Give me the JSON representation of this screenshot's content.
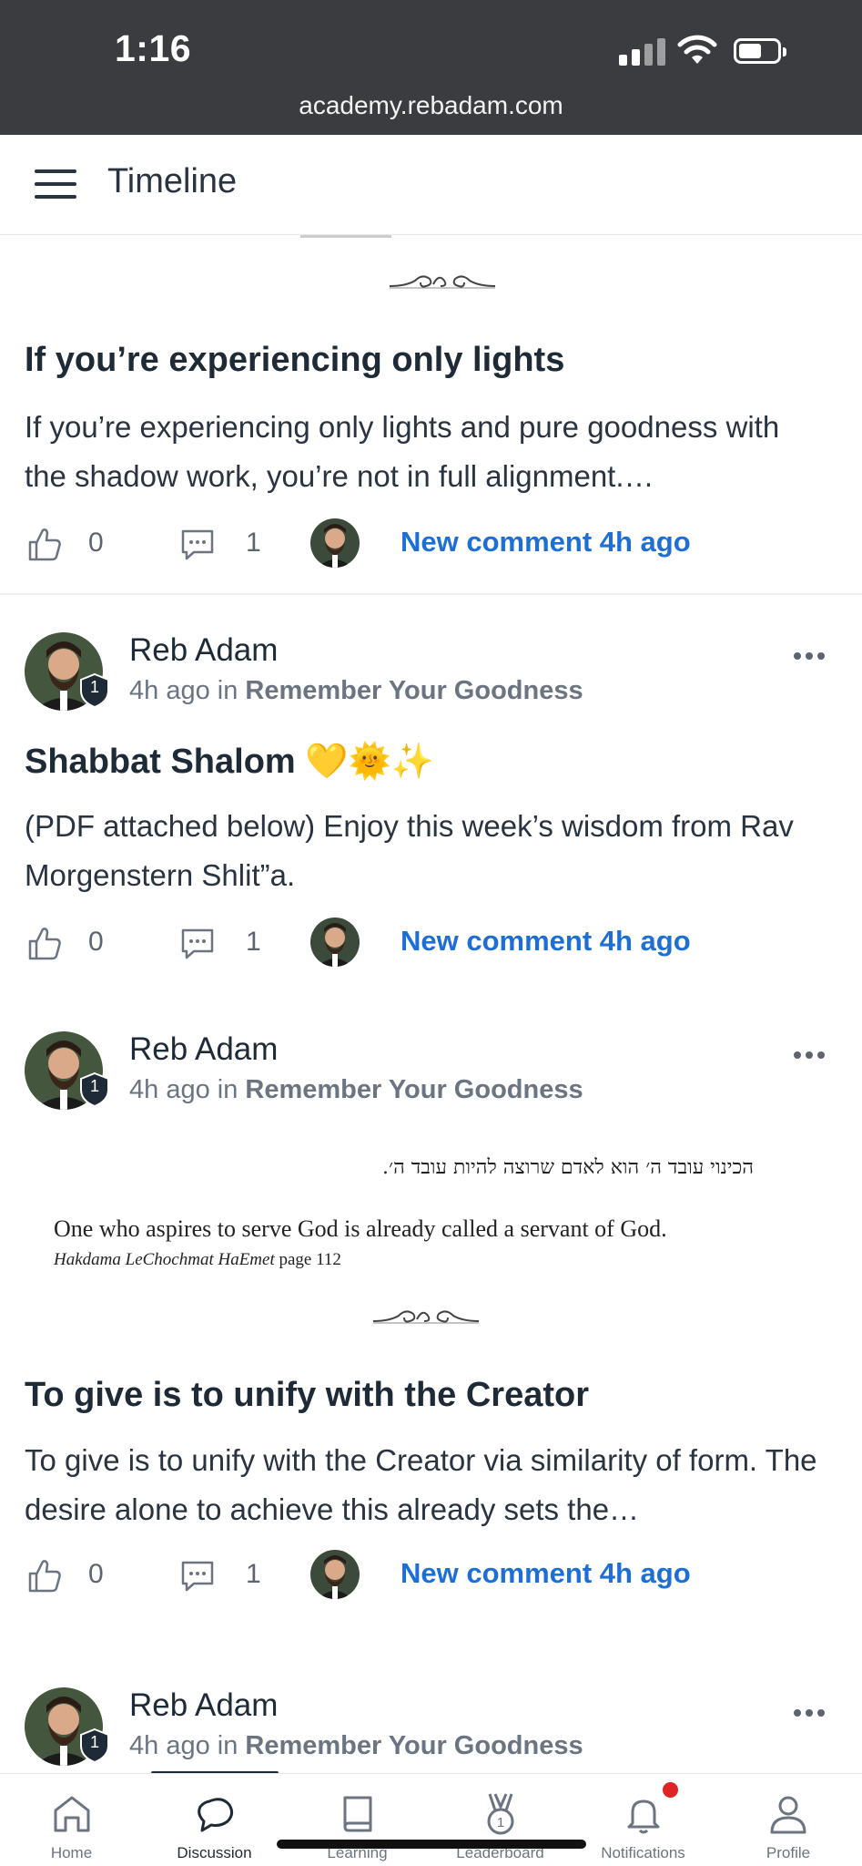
{
  "status_bar": {
    "time": "1:16",
    "url": "academy.rebadam.com",
    "icons": [
      "signal-icon",
      "wifi-icon",
      "battery-icon"
    ]
  },
  "header": {
    "title": "Timeline",
    "menu_icon": "hamburger-menu-icon"
  },
  "posts": [
    {
      "title": "If you’re experiencing only lights",
      "excerpt": "If you’re experiencing only lights and pure goodness with the shadow work, you’re not in full alignment.…",
      "likes": "0",
      "comments": "1",
      "new_comment": "New comment 4h ago"
    },
    {
      "author": "Reb Adam",
      "badge": "1",
      "time": "4h ago",
      "in_label": "in",
      "group": "Remember Your Goodness",
      "title": "Shabbat Shalom 💛🌞✨",
      "excerpt": "(PDF attached below) Enjoy this week’s wisdom from Rav Morgenstern Shlit”a.",
      "likes": "0",
      "comments": "1",
      "new_comment": "New comment 4h ago"
    },
    {
      "author": "Reb Adam",
      "badge": "1",
      "time": "4h ago",
      "in_label": "in",
      "group": "Remember Your Goodness",
      "image": {
        "hebrew": "הכינוי עובד ה׳ הוא לאדם שרוצה להיות עובד ה׳.",
        "english": "One who aspires to serve God is already called a servant of God.",
        "source_title": "Hakdama LeChochmat HaEmet",
        "source_page": " page 112"
      },
      "title": "To give is to unify with the Creator",
      "excerpt": "To give is to unify with the Creator via similarity of form. The desire alone to achieve this already sets the…",
      "likes": "0",
      "comments": "1",
      "new_comment": "New comment 4h ago"
    },
    {
      "author": "Reb Adam",
      "badge": "1",
      "time": "4h ago",
      "in_label": "in",
      "group": "Remember Your Goodness"
    }
  ],
  "tabbar": {
    "tabs": [
      {
        "label": "Home",
        "icon": "home-icon"
      },
      {
        "label": "Discussion",
        "icon": "discussion-icon"
      },
      {
        "label": "Learning",
        "icon": "book-icon"
      },
      {
        "label": "Leaderboard",
        "icon": "medal-icon"
      },
      {
        "label": "Notifications",
        "icon": "bell-icon"
      },
      {
        "label": "Profile",
        "icon": "user-icon"
      }
    ],
    "active": "Discussion"
  },
  "colors": {
    "status_bar_bg": "#3a3c3f",
    "link_blue": "#1d6fd6",
    "notification_dot": "#e02424",
    "text_dark": "#1f2a37"
  }
}
